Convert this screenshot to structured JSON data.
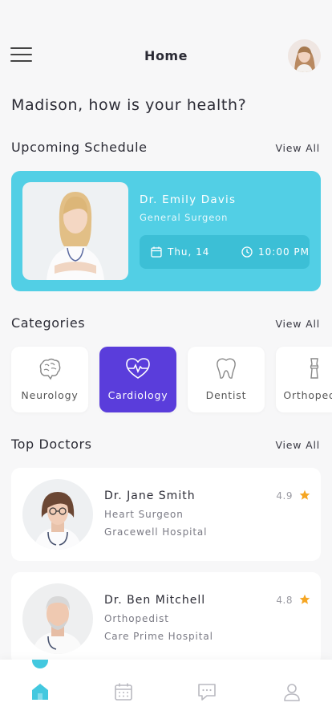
{
  "header": {
    "title": "Home"
  },
  "greeting": "Madison, how is your health?",
  "schedule": {
    "title": "Upcoming Schedule",
    "view_all": "View All",
    "doctor_name": "Dr. Emily Davis",
    "specialty": "General Surgeon",
    "date": "Thu, 14",
    "time": "10:00 PM"
  },
  "categories": {
    "title": "Categories",
    "view_all": "View All",
    "items": [
      {
        "label": "Neurology",
        "icon": "brain-icon"
      },
      {
        "label": "Cardiology",
        "icon": "heart-pulse-icon",
        "active": true
      },
      {
        "label": "Dentist",
        "icon": "tooth-icon"
      },
      {
        "label": "Orthopedic",
        "icon": "bone-joint-icon"
      }
    ]
  },
  "top_doctors": {
    "title": "Top Doctors",
    "view_all": "View All",
    "items": [
      {
        "name": "Dr. Jane Smith",
        "specialty": "Heart Surgeon",
        "hospital": "Gracewell Hospital",
        "rating": "4.9"
      },
      {
        "name": "Dr. Ben Mitchell",
        "specialty": "Orthopedist",
        "hospital": "Care Prime Hospital",
        "rating": "4.8"
      }
    ]
  },
  "bottom_nav": {
    "items": [
      "home-icon",
      "calendar-icon",
      "chat-icon",
      "profile-icon"
    ],
    "active": "home-icon"
  },
  "colors": {
    "primary": "#52cfe5",
    "accent": "#5a3ddb",
    "star": "#f5a623",
    "background": "#f7f7f8"
  }
}
